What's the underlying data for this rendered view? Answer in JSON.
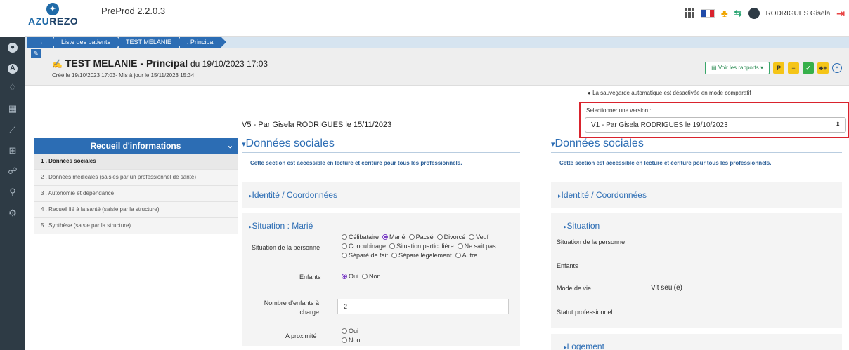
{
  "app": {
    "logo_text_a": "AZU",
    "logo_text_b": "REZO",
    "version": "PreProd 2.2.0.3",
    "user_name": "RODRIGUES Gisela"
  },
  "colors": {
    "primary": "#2c6db4",
    "sidebar": "#2e3b45",
    "highlight": "#d9232d",
    "accent_green": "#36b04a",
    "accent_yellow": "#f5c518"
  },
  "breadcrumb": [
    {
      "label": "←"
    },
    {
      "label": "Liste des patients"
    },
    {
      "label": "TEST MELANIE"
    },
    {
      "label": ": Principal"
    }
  ],
  "document": {
    "title": "TEST MELANIE - Principal",
    "title_suffix": "du 19/10/2023 17:03",
    "meta": "Créé le 19/10/2023 17:03- Mis à jour le 15/11/2023 15:34",
    "reports_button": "Voir les rapports",
    "action_p": "P",
    "action_list": "≡",
    "action_check": "✓",
    "action_add": "+"
  },
  "nav": {
    "title": "Recueil d'informations",
    "items": [
      {
        "label": "1 . Données sociales"
      },
      {
        "label": "2 . Données médicales (saisies par un professionnel de santé)"
      },
      {
        "label": "3 . Autonomie et dépendance"
      },
      {
        "label": "4 . Recueil lié à la santé (saisie par la structure)"
      },
      {
        "label": "5 . Synthèse (saisie par la structure)"
      }
    ]
  },
  "compare": {
    "auto_save_note": "La sauvegarde automatique est désactivée en mode comparatif",
    "select_label": "Selectionner une version :",
    "selected_version": "V1 - Par Gisela RODRIGUES le 19/10/2023"
  },
  "left_col": {
    "version_label": "V5 - Par Gisela RODRIGUES le 15/11/2023",
    "section_title": "Données sociales",
    "info": "Cette section est accessible en lecture et écriture pour tous les professionnels.",
    "identity_title": "Identité / Coordonnées",
    "situation_title": "Situation : Marié",
    "situation_label": "Situation de la personne",
    "situation_line1": [
      "Célibataire",
      "Marié",
      "Pacsé",
      "Divorcé",
      "Veuf"
    ],
    "situation_line2": [
      "Concubinage",
      "Situation particulière",
      "Ne sait pas"
    ],
    "situation_line3": [
      "Séparé de fait",
      "Séparé légalement",
      "Autre"
    ],
    "children_label": "Enfants",
    "children_yes": "Oui",
    "children_no": "Non",
    "children_count_label_1": "Nombre d'enfants à",
    "children_count_label_2": "charge",
    "children_count_value": "2",
    "proximity_label": "A proximité",
    "proximity_yes": "Oui",
    "proximity_no": "Non"
  },
  "right_col": {
    "section_title": "Données sociales",
    "info": "Cette section est accessible en lecture et écriture pour tous les professionnels.",
    "identity_title": "Identité / Coordonnées",
    "situation_title": "Situation",
    "situation_label": "Situation de la personne",
    "children_label": "Enfants",
    "living_label": "Mode de vie",
    "living_value": "Vit seul(e)",
    "job_label": "Statut professionnel",
    "housing_title": "Logement"
  }
}
